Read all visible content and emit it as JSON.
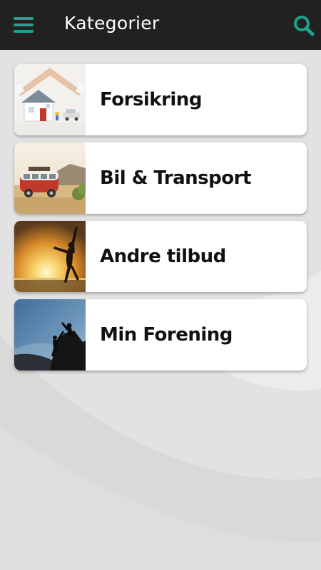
{
  "header": {
    "title": "Kategorier",
    "menu_icon": "hamburger-menu-icon",
    "search_icon": "search-icon",
    "accent_color": "#1fa38f",
    "background_color": "#212121"
  },
  "categories": [
    {
      "label": "Forsikring",
      "image": "house-insurance-photo"
    },
    {
      "label": "Bil & Transport",
      "image": "camper-van-beach-photo"
    },
    {
      "label": "Andre tilbud",
      "image": "sunset-jumping-woman-photo"
    },
    {
      "label": "Min Forening",
      "image": "mountain-climbers-photo"
    }
  ]
}
